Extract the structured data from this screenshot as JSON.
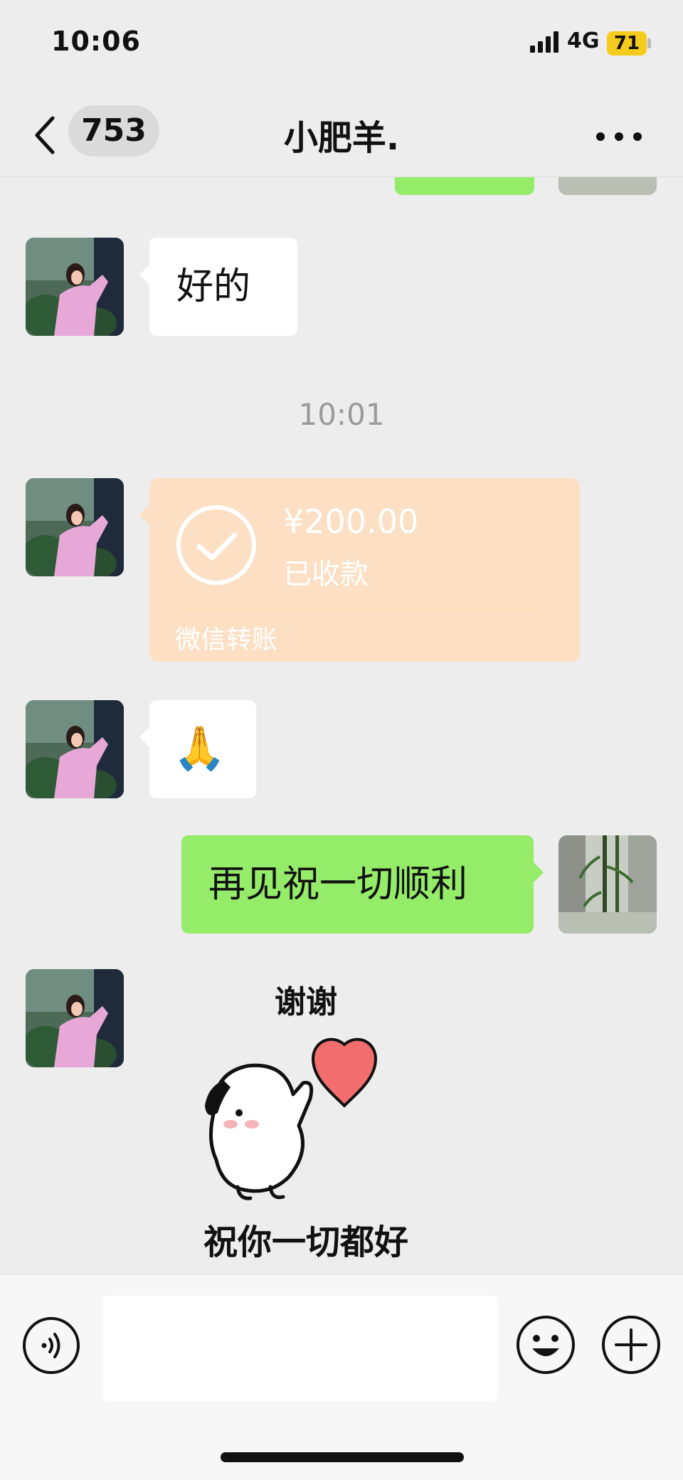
{
  "status_bar": {
    "time": "10:06",
    "network": "4G",
    "battery": "71",
    "battery_color": "#f5cc1c"
  },
  "nav": {
    "unread_count": "753",
    "title": "小肥羊."
  },
  "chat": {
    "messages": [
      {
        "side": "left",
        "type": "text",
        "text": "好的"
      },
      {
        "type": "time",
        "text": "10:01"
      },
      {
        "side": "left",
        "type": "transfer",
        "amount": "¥200.00",
        "status": "已收款",
        "footer": "微信转账"
      },
      {
        "side": "left",
        "type": "emoji",
        "emoji": "🙏"
      },
      {
        "side": "right",
        "type": "text",
        "text": "再见祝一切顺利"
      },
      {
        "side": "left",
        "type": "sticker",
        "caption_top": "谢谢",
        "caption_bottom": "祝你一切都好"
      }
    ]
  },
  "colors": {
    "background": "#ededed",
    "self_bubble": "#95ec69",
    "transfer_card": "#fddfc4",
    "sticker_heart": "#f26d6d"
  },
  "input_bar": {
    "text_value": ""
  }
}
